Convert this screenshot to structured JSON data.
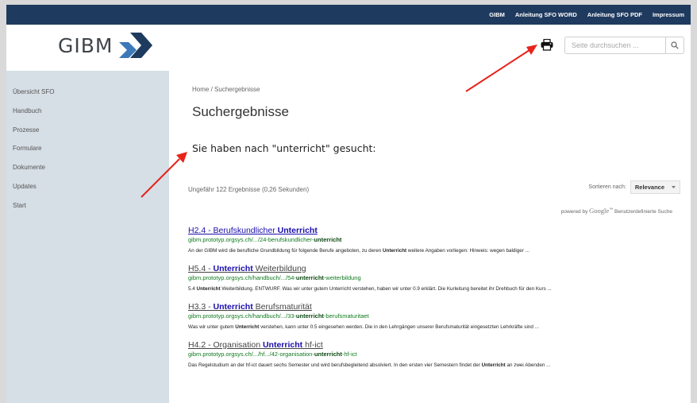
{
  "topnav": {
    "links": [
      "GIBM",
      "Anleitung SFO WORD",
      "Anleitung SFO PDF",
      "Impressum"
    ]
  },
  "logo": {
    "text": "GIBM"
  },
  "search": {
    "placeholder": "Seite durchsuchen ..."
  },
  "sidebar": {
    "items": [
      "Übersicht SFO",
      "Handbuch",
      "Prozesse",
      "Formulare",
      "Dokumente",
      "Updates",
      "Start"
    ]
  },
  "breadcrumb": {
    "home": "Home",
    "separator": "/",
    "current": "Suchergebnisse"
  },
  "page_title": "Suchergebnisse",
  "search_heading": "Sie haben nach \"unterricht\" gesucht:",
  "result_info": "Ungefähr 122 Ergebnisse (0,26 Sekunden)",
  "sort": {
    "label": "Sortieren nach:",
    "value": "Relevance"
  },
  "powered_by": {
    "prefix": "powered by",
    "brand": "Google",
    "suffix": "Benutzerdefinierte Suche"
  },
  "results": [
    {
      "title_pre": "H2.4 - Berufskundlicher ",
      "title_kw": "Unterricht",
      "title_post": "",
      "url_pre": "gibm.prototyp.orgsys.ch/.../24-berufskundlicher-",
      "url_kw": "unterricht",
      "url_post": "",
      "snippet_pre": "An der GIBM wird die berufliche Grundbildung für folgende Berufe angeboten, zu deren ",
      "snippet_kw": "Unterricht",
      "snippet_post": " weitere Angaben vorliegen: Hinweis: wegen baldiger ..."
    },
    {
      "title_pre": "H5.4 - ",
      "title_kw": "Unterricht",
      "title_post": " Weiterbildung",
      "url_pre": "gibm.prototyp.orgsys.ch/handbuch/.../54-",
      "url_kw": "unterricht",
      "url_post": "-weiterbildung",
      "snippet_pre": "5.4 ",
      "snippet_kw": "Unterricht",
      "snippet_post": " Weiterbildung. ENTWURF. Was wir unter gutem Unterricht verstehen, haben wir unter 0.9 erklärt. Die Kurleitung bereitet ihr Drehbuch für den Kurs ..."
    },
    {
      "title_pre": "H3.3 - ",
      "title_kw": "Unterricht",
      "title_post": " Berufsmaturität",
      "url_pre": "gibm.prototyp.orgsys.ch/handbuch/.../33-",
      "url_kw": "unterricht",
      "url_post": "-berufsmaturitaet",
      "snippet_pre": "Was wir unter gutem ",
      "snippet_kw": "Unterricht",
      "snippet_post": " verstehen, kann unter 0.5 eingesehen werden. Die in den Lehrgängen unserer Berufsmaturität eingesetzten Lehrkräfte sind ..."
    },
    {
      "title_pre": "H4.2 - Organisation ",
      "title_kw": "Unterricht",
      "title_post": " hf-ict",
      "url_pre": "gibm.prototyp.orgsys.ch/.../hf.../42-organisation-",
      "url_kw": "unterricht",
      "url_post": "-hf-ict",
      "snippet_pre": "Das Regelstudium an der hf-ict dauert sechs Semester und wird berufsbegleitend absolviert. In den ersten vier Semestern findet der ",
      "snippet_kw": "Unterricht",
      "snippet_post": " an zwei Abenden ..."
    }
  ],
  "colors": {
    "topbar": "#1f3a5f",
    "sidebar": "#d6dfe6",
    "link": "#1a0dab",
    "url": "#0f7a1e",
    "arrow": "#e8231b"
  }
}
